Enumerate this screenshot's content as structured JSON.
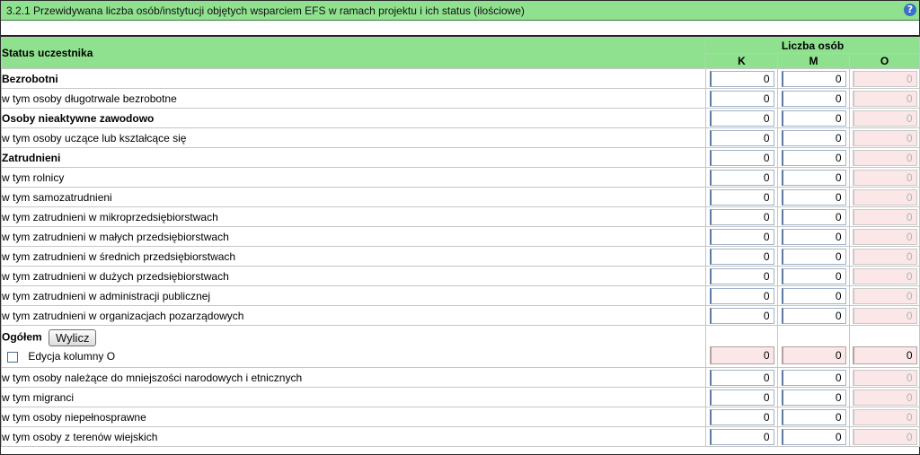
{
  "title": "3.2.1 Przewidywana liczba osób/instytucji objętych wsparciem EFS w ramach projektu i ich status (ilościowe)",
  "help_icon": "?",
  "header": {
    "status_label": "Status uczestnika",
    "group_label": "Liczba osób",
    "col_k": "K",
    "col_m": "M",
    "col_o": "O"
  },
  "rows_top": [
    {
      "label": "Bezrobotni",
      "k": "0",
      "m": "0",
      "o": "0"
    },
    {
      "label": "w tym osoby długotrwale bezrobotne",
      "k": "0",
      "m": "0",
      "o": "0"
    },
    {
      "label": "Osoby nieaktywne zawodowo",
      "k": "0",
      "m": "0",
      "o": "0"
    },
    {
      "label": "w tym osoby uczące lub kształcące się",
      "k": "0",
      "m": "0",
      "o": "0"
    },
    {
      "label": "Zatrudnieni",
      "k": "0",
      "m": "0",
      "o": "0"
    },
    {
      "label": "w tym rolnicy",
      "k": "0",
      "m": "0",
      "o": "0"
    },
    {
      "label": "w tym samozatrudnieni",
      "k": "0",
      "m": "0",
      "o": "0"
    },
    {
      "label": "w tym zatrudnieni w mikroprzedsiębiorstwach",
      "k": "0",
      "m": "0",
      "o": "0"
    },
    {
      "label": "w tym zatrudnieni w małych przedsiębiorstwach",
      "k": "0",
      "m": "0",
      "o": "0"
    },
    {
      "label": "w tym zatrudnieni w średnich przedsiębiorstwach",
      "k": "0",
      "m": "0",
      "o": "0"
    },
    {
      "label": "w tym zatrudnieni w dużych przedsiębiorstwach",
      "k": "0",
      "m": "0",
      "o": "0"
    },
    {
      "label": "w tym zatrudnieni w administracji publicznej",
      "k": "0",
      "m": "0",
      "o": "0"
    },
    {
      "label": "w tym zatrudnieni w organizacjach pozarządowych",
      "k": "0",
      "m": "0",
      "o": "0"
    }
  ],
  "total": {
    "label": "Ogółem",
    "button": "Wylicz",
    "checkbox_label": "Edycja kolumny O",
    "k": "0",
    "m": "0",
    "o": "0"
  },
  "rows_bottom": [
    {
      "label": "w tym osoby należące do mniejszości narodowych i etnicznych",
      "k": "0",
      "m": "0",
      "o": "0"
    },
    {
      "label": "w tym migranci",
      "k": "0",
      "m": "0",
      "o": "0"
    },
    {
      "label": "w tym osoby niepełnosprawne",
      "k": "0",
      "m": "0",
      "o": "0"
    },
    {
      "label": "w tym osoby z terenów wiejskich",
      "k": "0",
      "m": "0",
      "o": "0"
    }
  ]
}
